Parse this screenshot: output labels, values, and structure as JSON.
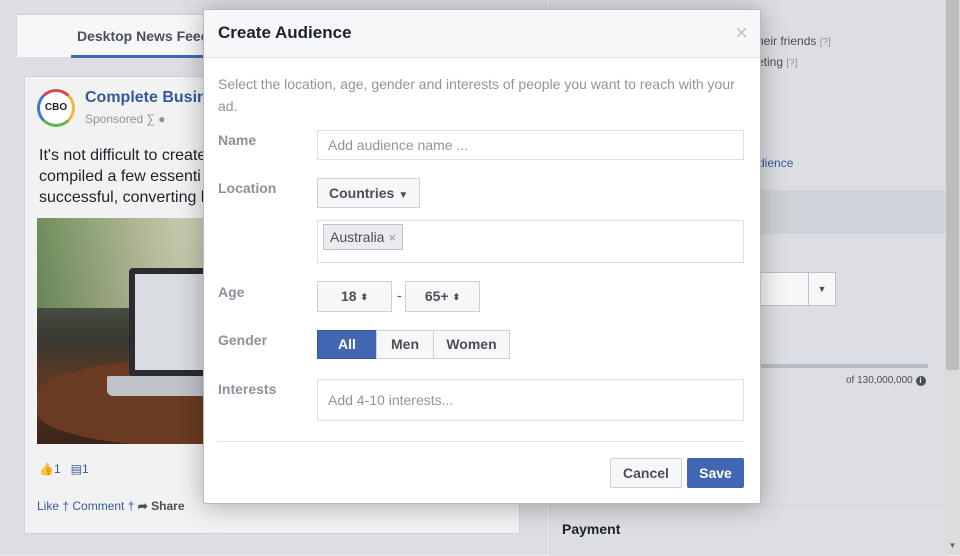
{
  "feed": {
    "tab_label": "Desktop News Feed",
    "post": {
      "logo_text": "CBO",
      "page_name": "Complete Busin",
      "sponsored": "Sponsored ∑ ●",
      "text_lines": [
        "It's not difficult to create",
        "compiled a few essenti",
        "successful, converting l"
      ],
      "like_count": "1",
      "comment_count": "1",
      "actions": {
        "like": "Like",
        "comment": "Comment",
        "share": "Share"
      }
    }
  },
  "right_panel": {
    "line1": "heir friends",
    "line1_help": "[?]",
    "line2": "eting",
    "line2_help": "[?]",
    "link": "dience",
    "reach": "of 130,000,000",
    "reach_info_icon": "info-icon",
    "payment_label": "Payment"
  },
  "modal": {
    "title": "Create Audience",
    "close_icon": "×",
    "description": "Select the location, age, gender and interests of people you want to reach with your ad.",
    "name": {
      "label": "Name",
      "placeholder": "Add audience name ..."
    },
    "location": {
      "label": "Location",
      "dropdown_label": "Countries",
      "caret": "▼",
      "tokens": [
        {
          "label": "Australia",
          "remove": "×"
        }
      ]
    },
    "age": {
      "label": "Age",
      "min": "18",
      "max": "65+",
      "separator": "-",
      "stepper": "⬍"
    },
    "gender": {
      "label": "Gender",
      "options": [
        "All",
        "Men",
        "Women"
      ],
      "selected": "All"
    },
    "interests": {
      "label": "Interests",
      "placeholder": "Add 4-10 interests..."
    },
    "buttons": {
      "cancel": "Cancel",
      "save": "Save"
    }
  },
  "colors": {
    "accent": "#4267b2",
    "link": "#365899",
    "overlay": "#dcdee3"
  }
}
